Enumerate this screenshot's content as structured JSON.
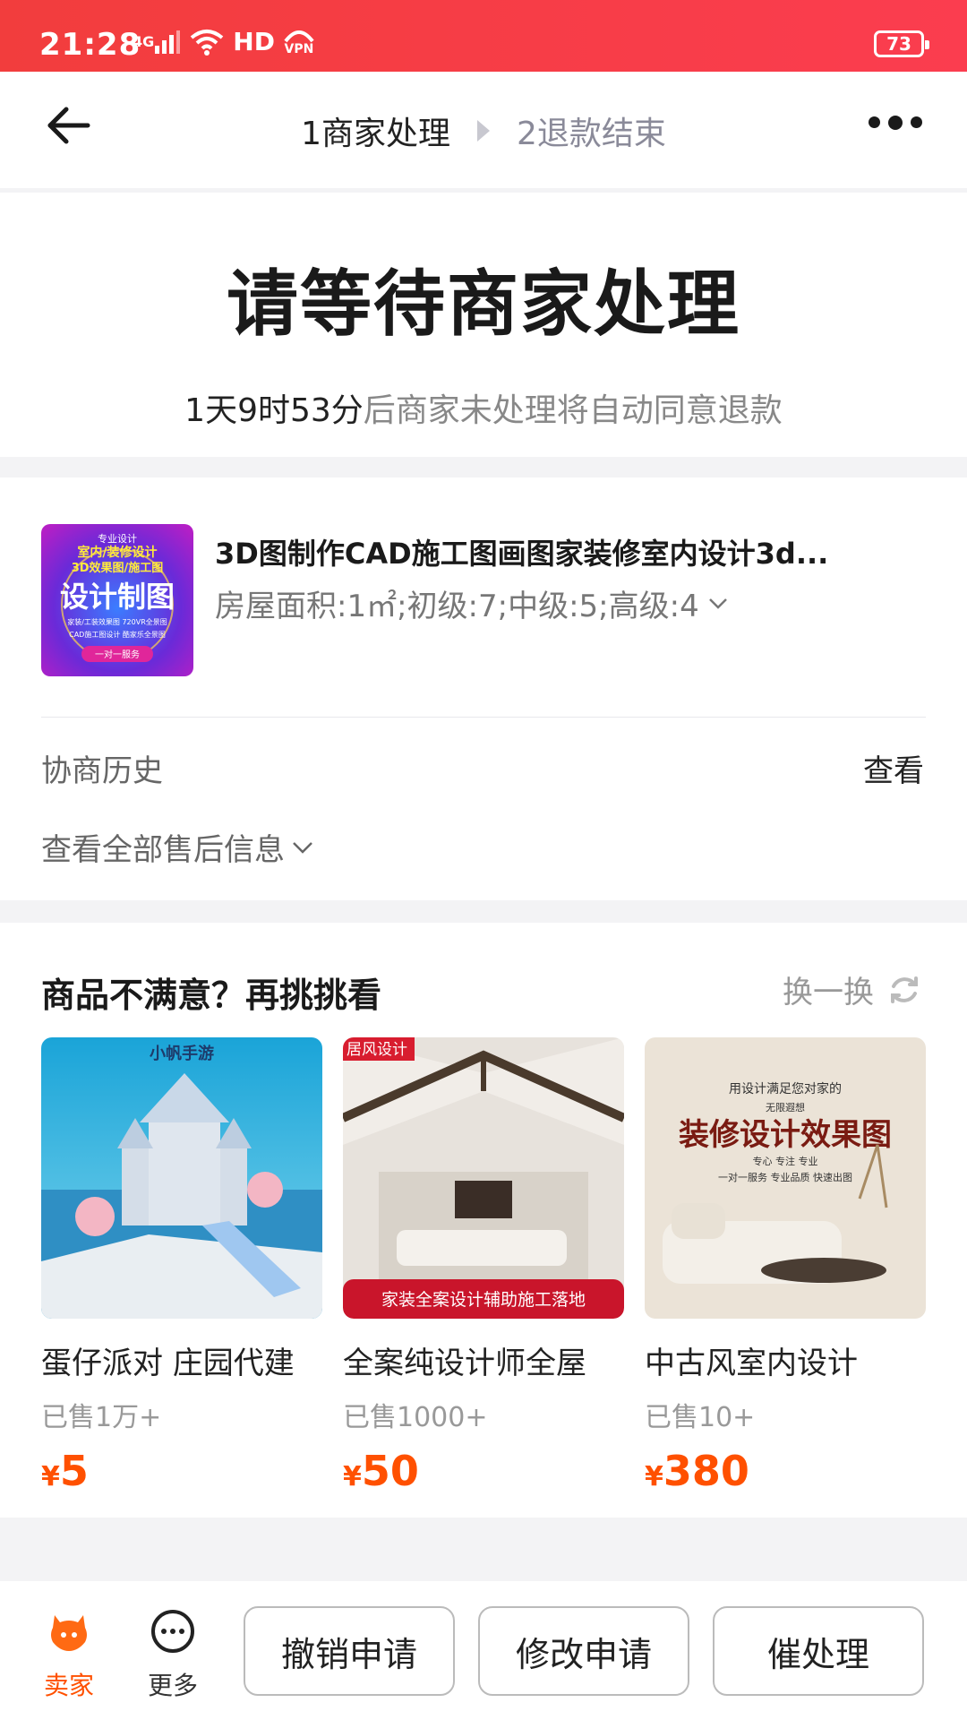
{
  "status_bar": {
    "time": "21:28",
    "network": "4G",
    "hd": "HD",
    "vpn": "VPN",
    "battery": "73"
  },
  "nav": {
    "step1": "1商家处理",
    "step2": "2退款结束"
  },
  "header": {
    "title": "请等待商家处理",
    "countdown": "1天9时53分",
    "subtitle_rest": "后商家未处理将自动同意退款"
  },
  "product": {
    "title": "3D图制作CAD施工图画图家装修室内设计3d...",
    "spec": "房屋面积:1㎡;初级:7;中级:5;高级:4",
    "thumb_text": {
      "top": "专业设计",
      "line1": "室内/装修设计",
      "line2": "3D效果图/施工图",
      "big": "设计制图",
      "small1": "家装/工装效果图 720VR全景图",
      "small2": "CAD施工图设计 酷家乐全景图",
      "badge": "一对一服务"
    },
    "history_label": "协商历史",
    "history_view": "查看",
    "aftersale_all": "查看全部售后信息"
  },
  "recommendations": {
    "title": "商品不满意？再挑挑看",
    "refresh": "换一换",
    "items": [
      {
        "name": "蛋仔派对 庄园代建",
        "sold": "已售1万+",
        "currency": "¥",
        "price": "5",
        "img_text": "小帆手游"
      },
      {
        "name": "全案纯设计师全屋",
        "sold": "已售1000+",
        "currency": "¥",
        "price": "50",
        "img_text": "居风设计",
        "img_banner": "家装全案设计辅助施工落地"
      },
      {
        "name": "中古风室内设计",
        "sold": "已售10+",
        "currency": "¥",
        "price": "380",
        "img_top": "用设计满足您对家的",
        "img_sub": "无限遐想",
        "img_big": "装修设计效果图",
        "img_line": "专心 专注 专业",
        "img_line2": "一对一服务 专业品质 快速出图"
      }
    ]
  },
  "bottom_bar": {
    "seller": "卖家",
    "more": "更多",
    "cancel": "撤销申请",
    "modify": "修改申请",
    "urge": "催处理"
  },
  "colors": {
    "accent": "#ff5000",
    "status_bar": "#f53d45"
  }
}
